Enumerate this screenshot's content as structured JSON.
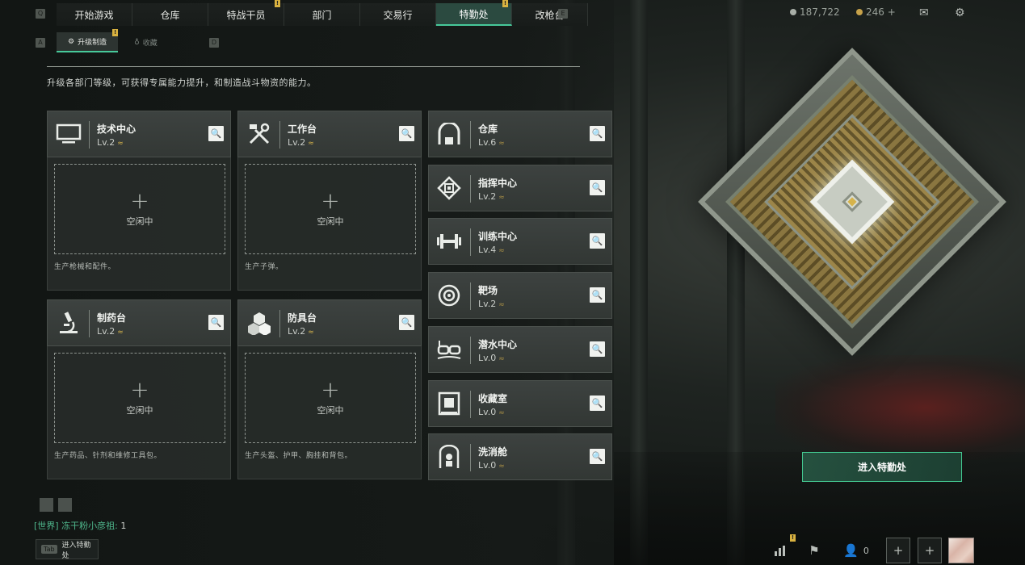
{
  "nav": {
    "key_left": "Q",
    "key_right": "E",
    "tabs": [
      {
        "label": "开始游戏",
        "active": false,
        "badge": false
      },
      {
        "label": "仓库",
        "active": false,
        "badge": false
      },
      {
        "label": "特战干员",
        "active": false,
        "badge": true
      },
      {
        "label": "部门",
        "active": false,
        "badge": false
      },
      {
        "label": "交易行",
        "active": false,
        "badge": false
      },
      {
        "label": "特勤处",
        "active": true,
        "badge": true
      },
      {
        "label": "改枪台",
        "active": false,
        "badge": false
      }
    ],
    "badge_text": "!"
  },
  "subnav": {
    "key_left": "A",
    "key_right": "D",
    "tabs": [
      {
        "label": "升级制造",
        "active": true
      },
      {
        "label": "收藏",
        "active": false
      }
    ]
  },
  "description": "升级各部门等级，可获得专属能力提升，和制造战斗物资的能力。",
  "resources": {
    "coins": "187,722",
    "gold": "246 +"
  },
  "production_cards": [
    {
      "name": "技术中心",
      "level": "Lv.2",
      "icon": "monitor-icon",
      "slot_plus": "+",
      "slot_status": "空闲中",
      "text": "生产枪械和配件。"
    },
    {
      "name": "工作台",
      "level": "Lv.2",
      "icon": "tools-icon",
      "slot_plus": "+",
      "slot_status": "空闲中",
      "text": "生产子弹。"
    },
    {
      "name": "制药台",
      "level": "Lv.2",
      "icon": "microscope-icon",
      "slot_plus": "+",
      "slot_status": "空闲中",
      "text": "生产药品、针剂和维修工具包。"
    },
    {
      "name": "防具台",
      "level": "Lv.2",
      "icon": "cubes-icon",
      "slot_plus": "+",
      "slot_status": "空闲中",
      "text": "生产头盔、护甲、胸挂和背包。"
    }
  ],
  "departments": [
    {
      "name": "仓库",
      "level": "Lv.6",
      "icon": "warehouse-icon"
    },
    {
      "name": "指挥中心",
      "level": "Lv.2",
      "icon": "command-chip-icon"
    },
    {
      "name": "训练中心",
      "level": "Lv.4",
      "icon": "dumbbell-icon"
    },
    {
      "name": "靶场",
      "level": "Lv.2",
      "icon": "target-icon"
    },
    {
      "name": "潜水中心",
      "level": "Lv.0",
      "icon": "diving-mask-icon"
    },
    {
      "name": "收藏室",
      "level": "Lv.0",
      "icon": "collection-icon"
    },
    {
      "name": "洗消舱",
      "level": "Lv.0",
      "icon": "decon-pod-icon"
    }
  ],
  "level_chevron": "≈",
  "enter_button": "进入特勤处",
  "chat": {
    "channel": "[世界]",
    "name": "冻干粉小彦祖:",
    "message": "1"
  },
  "tab_hint": {
    "key": "Tab",
    "label": "进入特勤处"
  },
  "bottom_right": {
    "friends_count": "0",
    "plus": "+"
  },
  "colors": {
    "accent": "#47c99a",
    "badge": "#d9b240",
    "level_chevron": "#d3b24b"
  }
}
